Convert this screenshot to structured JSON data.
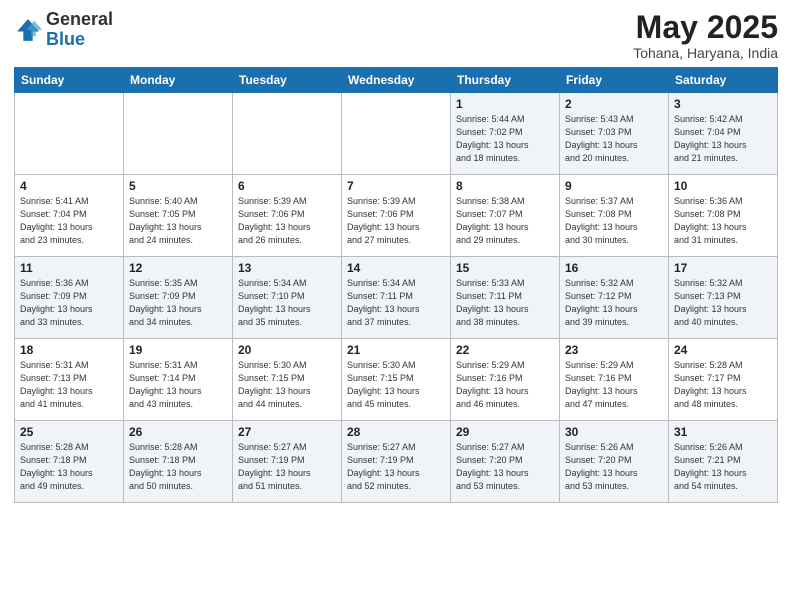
{
  "header": {
    "logo_general": "General",
    "logo_blue": "Blue",
    "month_title": "May 2025",
    "location": "Tohana, Haryana, India"
  },
  "weekdays": [
    "Sunday",
    "Monday",
    "Tuesday",
    "Wednesday",
    "Thursday",
    "Friday",
    "Saturday"
  ],
  "weeks": [
    [
      {
        "day": "",
        "info": ""
      },
      {
        "day": "",
        "info": ""
      },
      {
        "day": "",
        "info": ""
      },
      {
        "day": "",
        "info": ""
      },
      {
        "day": "1",
        "info": "Sunrise: 5:44 AM\nSunset: 7:02 PM\nDaylight: 13 hours\nand 18 minutes."
      },
      {
        "day": "2",
        "info": "Sunrise: 5:43 AM\nSunset: 7:03 PM\nDaylight: 13 hours\nand 20 minutes."
      },
      {
        "day": "3",
        "info": "Sunrise: 5:42 AM\nSunset: 7:04 PM\nDaylight: 13 hours\nand 21 minutes."
      }
    ],
    [
      {
        "day": "4",
        "info": "Sunrise: 5:41 AM\nSunset: 7:04 PM\nDaylight: 13 hours\nand 23 minutes."
      },
      {
        "day": "5",
        "info": "Sunrise: 5:40 AM\nSunset: 7:05 PM\nDaylight: 13 hours\nand 24 minutes."
      },
      {
        "day": "6",
        "info": "Sunrise: 5:39 AM\nSunset: 7:06 PM\nDaylight: 13 hours\nand 26 minutes."
      },
      {
        "day": "7",
        "info": "Sunrise: 5:39 AM\nSunset: 7:06 PM\nDaylight: 13 hours\nand 27 minutes."
      },
      {
        "day": "8",
        "info": "Sunrise: 5:38 AM\nSunset: 7:07 PM\nDaylight: 13 hours\nand 29 minutes."
      },
      {
        "day": "9",
        "info": "Sunrise: 5:37 AM\nSunset: 7:08 PM\nDaylight: 13 hours\nand 30 minutes."
      },
      {
        "day": "10",
        "info": "Sunrise: 5:36 AM\nSunset: 7:08 PM\nDaylight: 13 hours\nand 31 minutes."
      }
    ],
    [
      {
        "day": "11",
        "info": "Sunrise: 5:36 AM\nSunset: 7:09 PM\nDaylight: 13 hours\nand 33 minutes."
      },
      {
        "day": "12",
        "info": "Sunrise: 5:35 AM\nSunset: 7:09 PM\nDaylight: 13 hours\nand 34 minutes."
      },
      {
        "day": "13",
        "info": "Sunrise: 5:34 AM\nSunset: 7:10 PM\nDaylight: 13 hours\nand 35 minutes."
      },
      {
        "day": "14",
        "info": "Sunrise: 5:34 AM\nSunset: 7:11 PM\nDaylight: 13 hours\nand 37 minutes."
      },
      {
        "day": "15",
        "info": "Sunrise: 5:33 AM\nSunset: 7:11 PM\nDaylight: 13 hours\nand 38 minutes."
      },
      {
        "day": "16",
        "info": "Sunrise: 5:32 AM\nSunset: 7:12 PM\nDaylight: 13 hours\nand 39 minutes."
      },
      {
        "day": "17",
        "info": "Sunrise: 5:32 AM\nSunset: 7:13 PM\nDaylight: 13 hours\nand 40 minutes."
      }
    ],
    [
      {
        "day": "18",
        "info": "Sunrise: 5:31 AM\nSunset: 7:13 PM\nDaylight: 13 hours\nand 41 minutes."
      },
      {
        "day": "19",
        "info": "Sunrise: 5:31 AM\nSunset: 7:14 PM\nDaylight: 13 hours\nand 43 minutes."
      },
      {
        "day": "20",
        "info": "Sunrise: 5:30 AM\nSunset: 7:15 PM\nDaylight: 13 hours\nand 44 minutes."
      },
      {
        "day": "21",
        "info": "Sunrise: 5:30 AM\nSunset: 7:15 PM\nDaylight: 13 hours\nand 45 minutes."
      },
      {
        "day": "22",
        "info": "Sunrise: 5:29 AM\nSunset: 7:16 PM\nDaylight: 13 hours\nand 46 minutes."
      },
      {
        "day": "23",
        "info": "Sunrise: 5:29 AM\nSunset: 7:16 PM\nDaylight: 13 hours\nand 47 minutes."
      },
      {
        "day": "24",
        "info": "Sunrise: 5:28 AM\nSunset: 7:17 PM\nDaylight: 13 hours\nand 48 minutes."
      }
    ],
    [
      {
        "day": "25",
        "info": "Sunrise: 5:28 AM\nSunset: 7:18 PM\nDaylight: 13 hours\nand 49 minutes."
      },
      {
        "day": "26",
        "info": "Sunrise: 5:28 AM\nSunset: 7:18 PM\nDaylight: 13 hours\nand 50 minutes."
      },
      {
        "day": "27",
        "info": "Sunrise: 5:27 AM\nSunset: 7:19 PM\nDaylight: 13 hours\nand 51 minutes."
      },
      {
        "day": "28",
        "info": "Sunrise: 5:27 AM\nSunset: 7:19 PM\nDaylight: 13 hours\nand 52 minutes."
      },
      {
        "day": "29",
        "info": "Sunrise: 5:27 AM\nSunset: 7:20 PM\nDaylight: 13 hours\nand 53 minutes."
      },
      {
        "day": "30",
        "info": "Sunrise: 5:26 AM\nSunset: 7:20 PM\nDaylight: 13 hours\nand 53 minutes."
      },
      {
        "day": "31",
        "info": "Sunrise: 5:26 AM\nSunset: 7:21 PM\nDaylight: 13 hours\nand 54 minutes."
      }
    ]
  ]
}
